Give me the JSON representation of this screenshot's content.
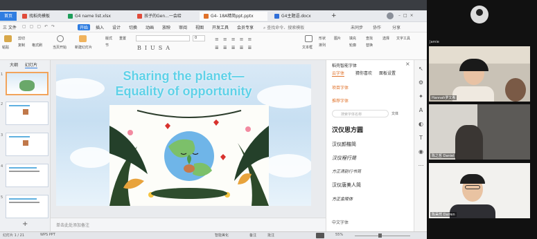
{
  "tabs": [
    {
      "label": "首页",
      "color": "#2f7de1"
    },
    {
      "label": "找稻壳模板",
      "color": "#e04b3a"
    },
    {
      "label": "G4 name list.xlsx",
      "color": "#1e9e5a"
    },
    {
      "label": "孩子的Gen...一会给",
      "color": "#e04b3a"
    },
    {
      "label": "G4- 18A精简ppt.pptx",
      "color": "#e0722a"
    },
    {
      "label": "G4主题语.docx",
      "color": "#2f6fd8"
    }
  ],
  "tab_add": "+",
  "menu": {
    "file": "三 文件",
    "items": [
      "开始",
      "插入",
      "设计",
      "切换",
      "动画",
      "放映",
      "审阅",
      "视图",
      "开发工具",
      "会员专享"
    ],
    "search": "查找命令、搜索模板",
    "right": [
      "未同步",
      "协作",
      "分享"
    ]
  },
  "ribbon": {
    "paste": "粘贴",
    "format": "格式刷",
    "cut": "剪切",
    "copy": "复制",
    "start_play": "当页开始",
    "new_slide": "新建幻灯片",
    "layout": "版式",
    "section": "节",
    "reset": "重置",
    "font_size": "0",
    "text_box": "文本框",
    "arrange": "排列",
    "shape": "形状",
    "picture": "图片",
    "fill": "填充",
    "outline": "轮廓",
    "find": "查找",
    "replace": "替换",
    "select": "选择",
    "text_tools": "文字工具"
  },
  "left_panel": {
    "tab_outline": "大纲",
    "tab_slides": "幻灯片",
    "slide_numbers": [
      "1",
      "2",
      "3",
      "4",
      "5"
    ],
    "add": "+"
  },
  "slide": {
    "title_line1": "Sharing the planet—",
    "title_line2": "Equality of opportunity"
  },
  "notes_placeholder": "单击此处添加备注",
  "right_panel": {
    "title": "稻壳智能字体",
    "tabs": [
      "云字体",
      "猜你喜欢",
      "面板设置"
    ],
    "section_project": "项目字体",
    "section_recommended": "推荐字体",
    "search_placeholder": "搜索字体名称",
    "filter": "文体",
    "fonts": [
      "汉仪思方圆",
      "汉仪颜楷简",
      "汉仪程行简",
      "方正清韵行书简",
      "汉仪唐美人简",
      "方正金陵体"
    ],
    "footer": "中文字体"
  },
  "statusbar": {
    "page": "幻灯片 1 / 21",
    "theme": "WPS PPT",
    "design": "智能美化",
    "notes": "备注",
    "comments": "批注",
    "zoom": "55%"
  },
  "participants": [
    {
      "name": "Jamie",
      "label": ""
    },
    {
      "name": "",
      "label": "Hannah罗文希"
    },
    {
      "name": "",
      "label": "陈之哲 Daniel"
    },
    {
      "name": "",
      "label": "陈昊然 Darren"
    }
  ]
}
